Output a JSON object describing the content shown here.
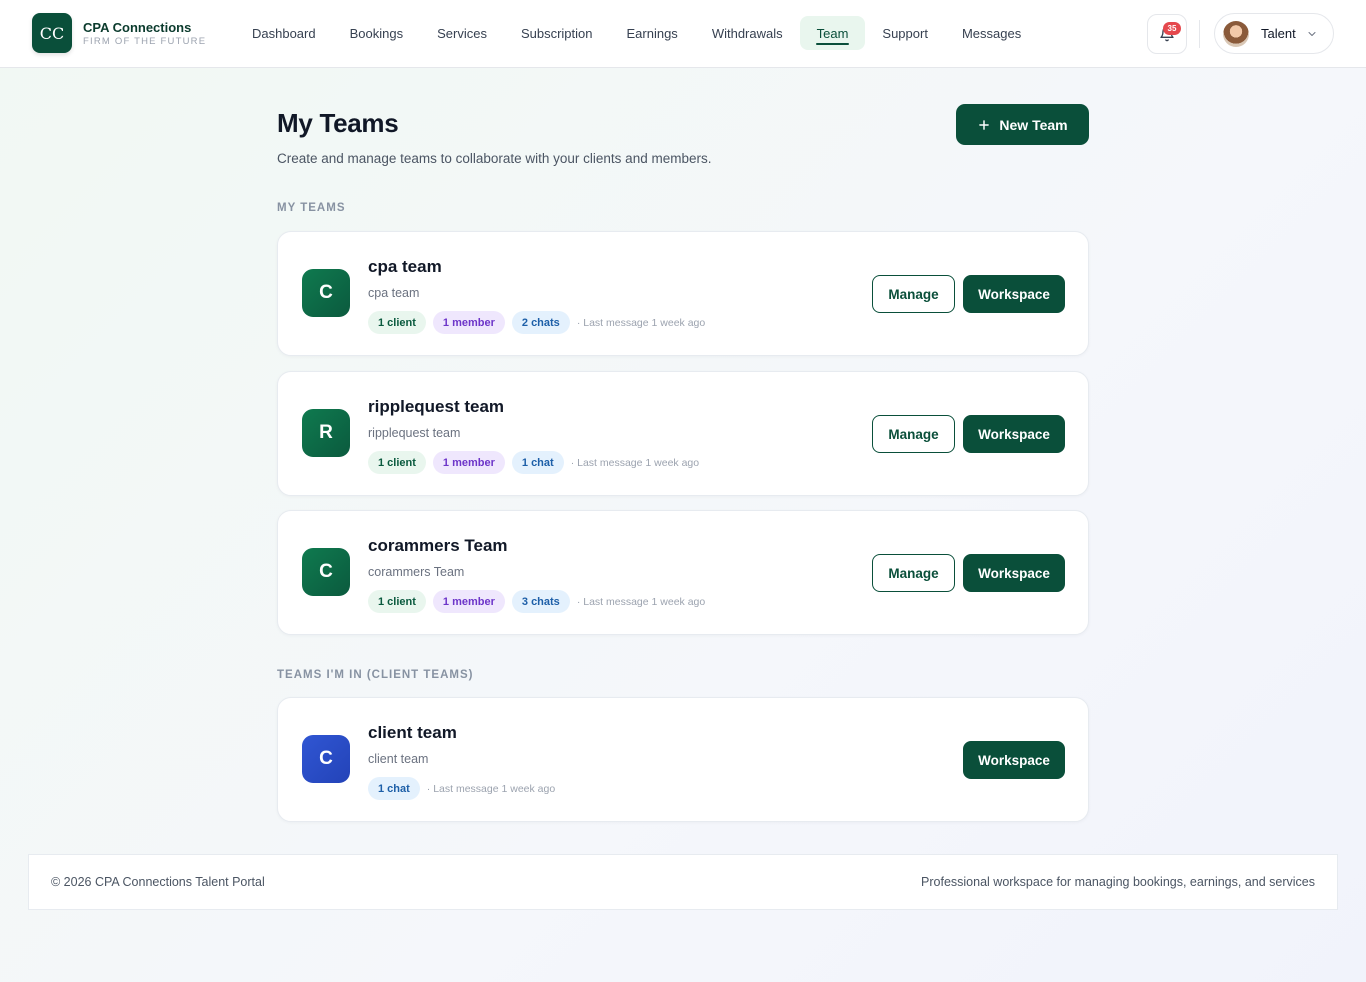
{
  "brand": {
    "logo_text": "CC",
    "name": "CPA Connections",
    "tagline": "FIRM OF THE FUTURE"
  },
  "nav": {
    "items": [
      {
        "label": "Dashboard",
        "active": false
      },
      {
        "label": "Bookings",
        "active": false
      },
      {
        "label": "Services",
        "active": false
      },
      {
        "label": "Subscription",
        "active": false
      },
      {
        "label": "Earnings",
        "active": false
      },
      {
        "label": "Withdrawals",
        "active": false
      },
      {
        "label": "Team",
        "active": true
      },
      {
        "label": "Support",
        "active": false
      },
      {
        "label": "Messages",
        "active": false
      }
    ]
  },
  "notifications": {
    "count": "35",
    "icon": "bell-icon"
  },
  "user": {
    "name": "Talent"
  },
  "page": {
    "title": "My Teams",
    "subtitle": "Create and manage teams to collaborate with your clients and members.",
    "new_team_label": "New Team"
  },
  "sections": {
    "my_teams_label": "MY TEAMS",
    "client_teams_label": "TEAMS I'M IN (CLIENT TEAMS)"
  },
  "buttons": {
    "manage": "Manage",
    "workspace": "Workspace"
  },
  "my_teams": [
    {
      "initial": "C",
      "name": "cpa team",
      "description": "cpa team",
      "clients": "1 client",
      "members": "1 member",
      "chats": "2 chats",
      "last_message": "· Last message 1 week ago"
    },
    {
      "initial": "R",
      "name": "ripplequest team",
      "description": "ripplequest team",
      "clients": "1 client",
      "members": "1 member",
      "chats": "1 chat",
      "last_message": "· Last message 1 week ago"
    },
    {
      "initial": "C",
      "name": "corammers Team",
      "description": "corammers Team",
      "clients": "1 client",
      "members": "1 member",
      "chats": "3 chats",
      "last_message": "· Last message 1 week ago"
    }
  ],
  "client_teams": [
    {
      "initial": "C",
      "name": "client team",
      "description": "client team",
      "chats": "1 chat",
      "last_message": "· Last message 1 week ago"
    }
  ],
  "colors": {
    "primary": "#0a4f3a",
    "client_avatar": "#3056d3",
    "badge": "#e5484d"
  },
  "footer": {
    "copyright": "© 2026 CPA Connections Talent Portal",
    "tagline": "Professional workspace for managing bookings, earnings, and services"
  }
}
